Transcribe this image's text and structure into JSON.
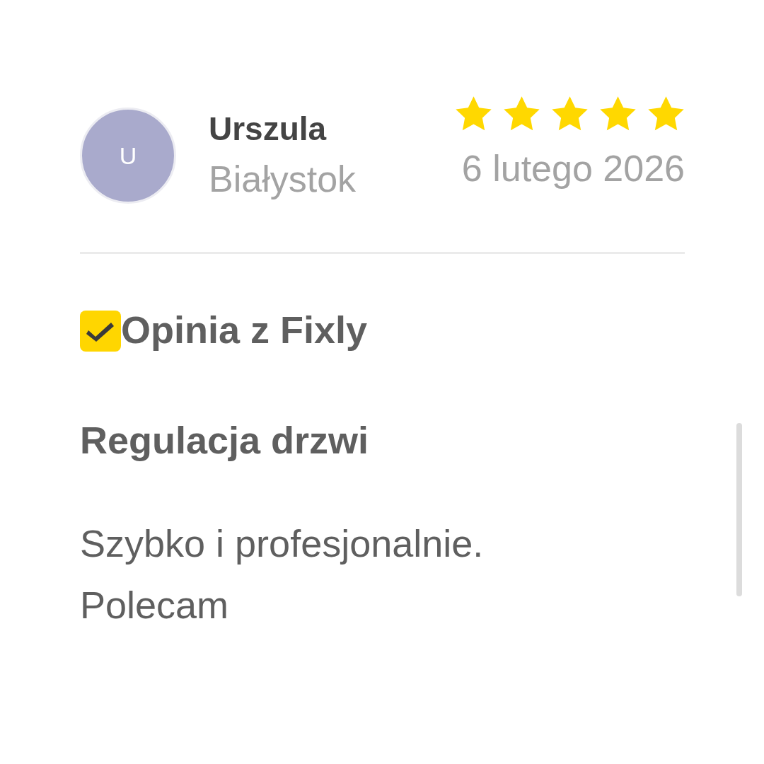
{
  "reviewer": {
    "initial": "U",
    "name": "Urszula",
    "location": "Białystok"
  },
  "rating": {
    "stars": 5
  },
  "date": "6 lutego 2026",
  "badge": {
    "label": "Opinia z Fixly"
  },
  "title": "Regulacja drzwi",
  "body": "Szybko i profesjonalnie. Polecam"
}
